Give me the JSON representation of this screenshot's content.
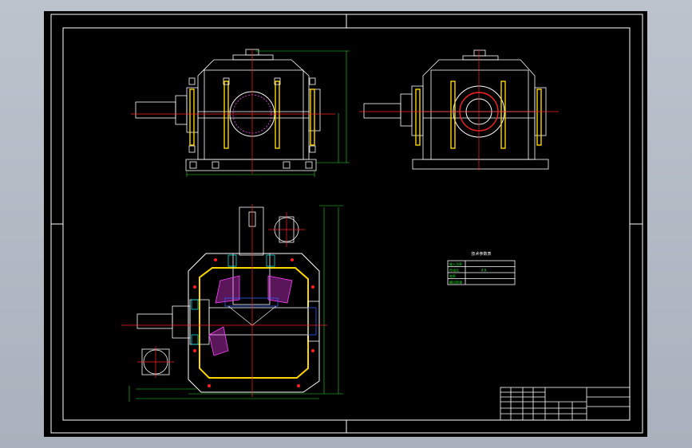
{
  "app": {
    "background": "#b8bfca",
    "canvas_color": "#000000"
  },
  "colors": {
    "border": "#ffffff",
    "outline": "#ffffff",
    "center_line": "#ff2020",
    "yellow": "#ffd400",
    "green": "#20e020",
    "magenta": "#ff40ff",
    "blue": "#3060ff",
    "cyan": "#00e0e0"
  },
  "tech_table": {
    "title": "技术参数表",
    "rows": [
      {
        "label": "输入功率",
        "value": ""
      },
      {
        "label": "传动比",
        "value": "4.9"
      },
      {
        "label": "效率",
        "value": ""
      },
      {
        "label": "输出转速",
        "value": ""
      }
    ]
  },
  "title_block": {
    "cells": []
  },
  "icons": [
    "center-mark-icon"
  ]
}
